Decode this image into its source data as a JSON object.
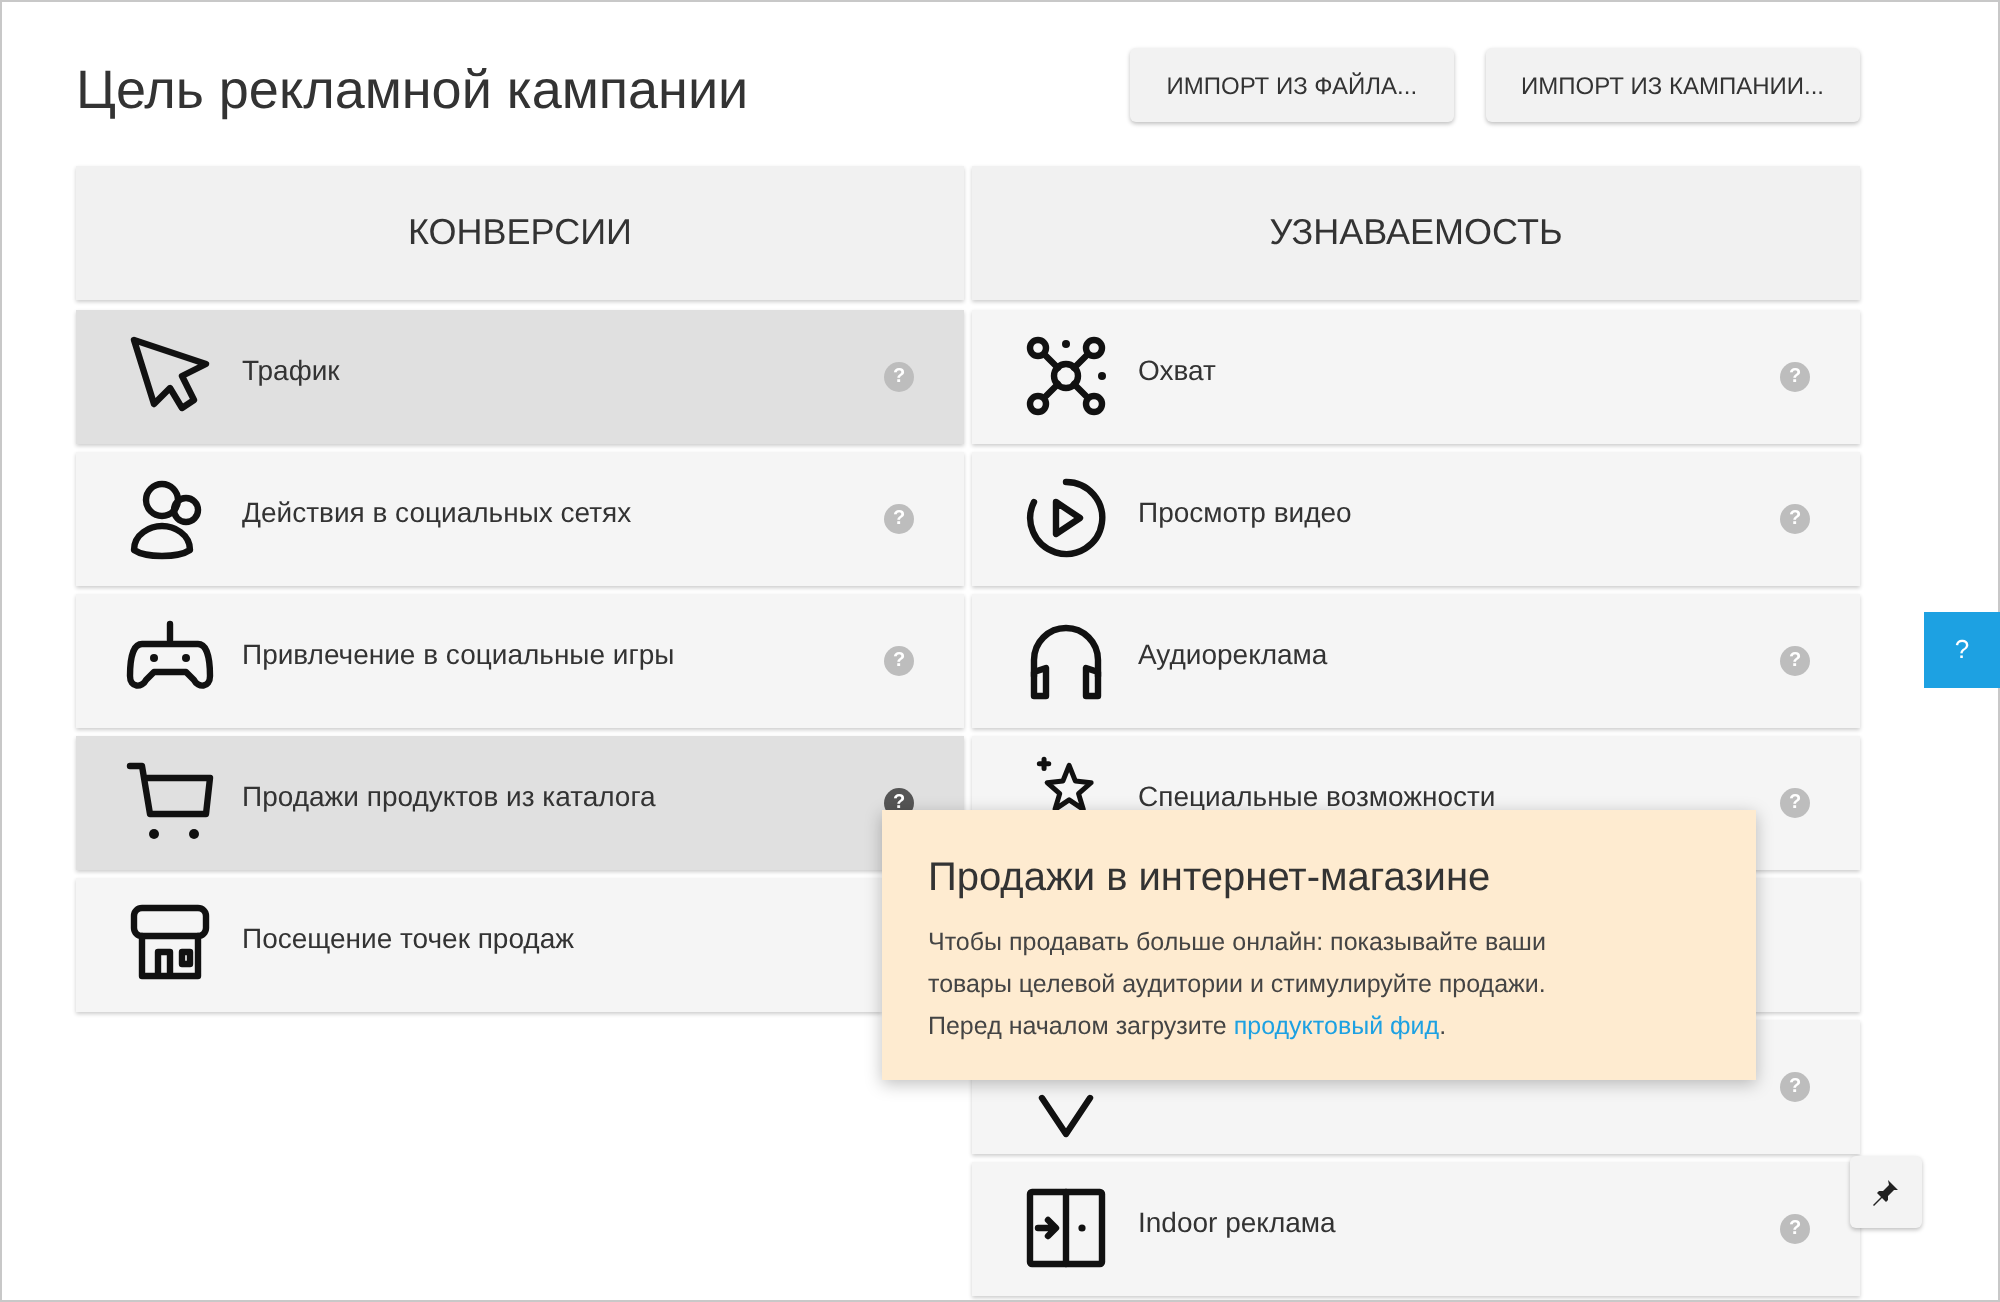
{
  "title": "Цель рекламной кампании",
  "buttons": [
    "ИМПОРТ ИЗ ФАЙЛА...",
    "ИМПОРТ ИЗ КАМПАНИИ..."
  ],
  "columns": [
    {
      "heading": "КОНВЕРСИИ",
      "items": [
        {
          "kind": "cursor",
          "label": "Трафик",
          "selected": true,
          "help": "?",
          "help_highlighted": false
        },
        {
          "kind": "people",
          "label": "Действия в социальных сетях",
          "selected": false,
          "help": "?",
          "help_highlighted": false
        },
        {
          "kind": "gamepad",
          "label": "Привлечение в социальные игры",
          "selected": false,
          "help": "?",
          "help_highlighted": false
        },
        {
          "kind": "cart",
          "label": "Продажи продуктов из каталога",
          "selected": true,
          "help": "?",
          "help_highlighted": true
        },
        {
          "kind": "store",
          "label": "Посещение точек продаж",
          "selected": false
        }
      ]
    },
    {
      "heading": "УЗНАВАЕМОСТЬ",
      "items": [
        {
          "kind": "network",
          "label": "Охват",
          "selected": false,
          "help": "?",
          "help_highlighted": false
        },
        {
          "kind": "play",
          "label": "Просмотр видео",
          "selected": false,
          "help": "?",
          "help_highlighted": false
        },
        {
          "kind": "headphones",
          "label": "Аудиореклама",
          "selected": false,
          "help": "?",
          "help_highlighted": false
        },
        {
          "kind": "stars",
          "label": "Специальные возможности",
          "selected": false,
          "help": "?",
          "help_highlighted": false
        },
        {
          "selected": false
        },
        {
          "kind": "pin",
          "selected": false,
          "help": "?",
          "help_highlighted": false
        },
        {
          "kind": "door",
          "label": "Indoor реклама",
          "selected": false,
          "help": "?",
          "help_highlighted": false
        }
      ]
    }
  ],
  "tooltip": {
    "title": "Продажи в интернет-магазине",
    "text": "Чтобы продавать больше онлайн: показывайте ваши товары целевой аудитории и стимулируйте продажи. Перед началом загрузите ",
    "link": "продуктовый фид",
    "after": "."
  },
  "side_tab": "?"
}
